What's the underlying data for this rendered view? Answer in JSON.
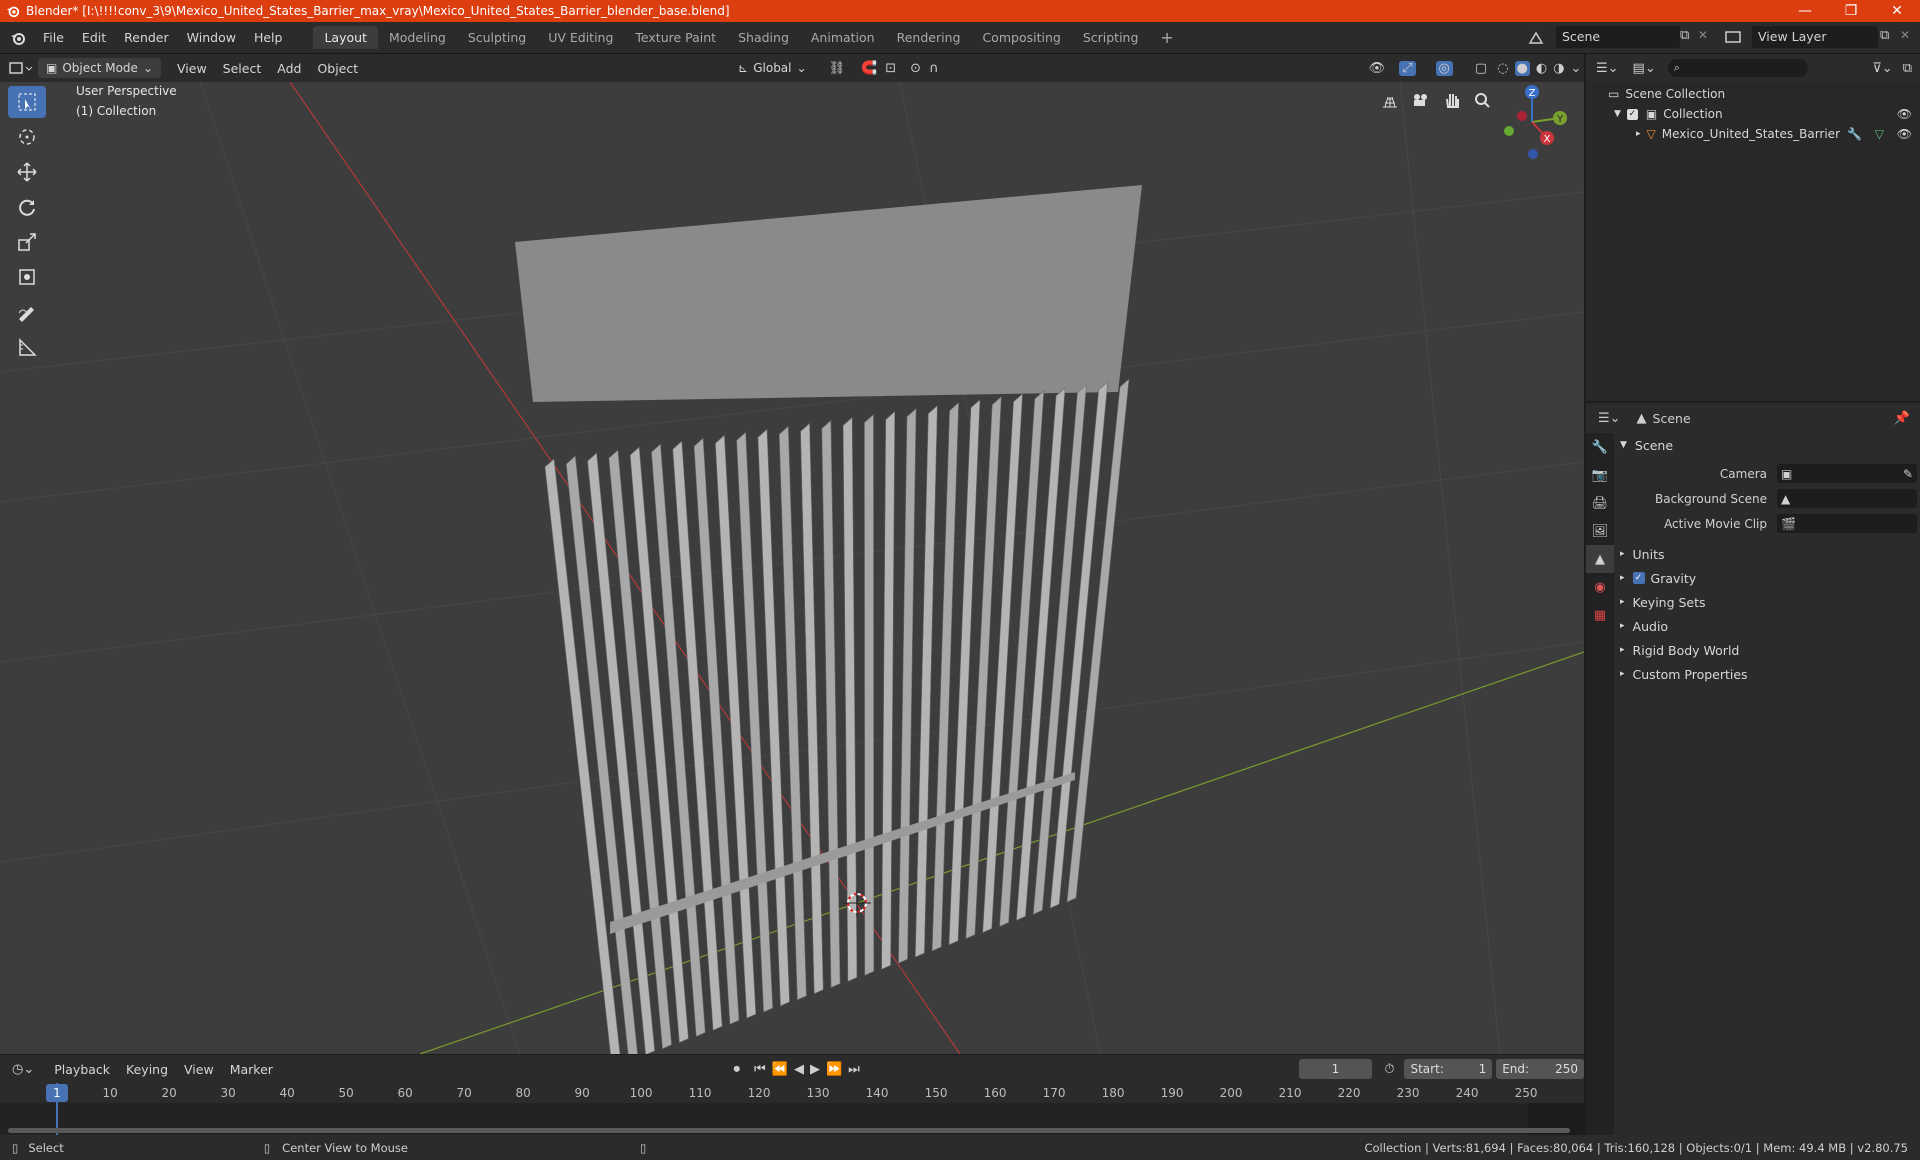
{
  "window": {
    "title": "Blender* [I:\\!!!!conv_3\\9\\Mexico_United_States_Barrier_max_vray\\Mexico_United_States_Barrier_blender_base.blend]",
    "minimize": "—",
    "maximize": "❐",
    "close": "✕"
  },
  "menus": [
    "File",
    "Edit",
    "Render",
    "Window",
    "Help"
  ],
  "workspaces": [
    "Layout",
    "Modeling",
    "Sculpting",
    "UV Editing",
    "Texture Paint",
    "Shading",
    "Animation",
    "Rendering",
    "Compositing",
    "Scripting"
  ],
  "active_workspace": "Layout",
  "scene_selector": {
    "value": "Scene"
  },
  "view_layer_selector": {
    "value": "View Layer"
  },
  "viewport_header": {
    "mode": "Object Mode",
    "menus": [
      "View",
      "Select",
      "Add",
      "Object"
    ],
    "orientation": "Global"
  },
  "viewport": {
    "perspective_label": "User Perspective",
    "collection_label": "(1) Collection",
    "gizmo": {
      "z": "Z",
      "y": "Y",
      "x": "X"
    }
  },
  "outliner": {
    "scene_collection": "Scene Collection",
    "collection": "Collection",
    "object": "Mexico_United_States_Barrier"
  },
  "properties": {
    "header_title": "Scene",
    "section_title": "Scene",
    "fields": [
      {
        "label": "Camera",
        "value": ""
      },
      {
        "label": "Background Scene",
        "value": ""
      },
      {
        "label": "Active Movie Clip",
        "value": ""
      }
    ],
    "subsections": [
      "Units",
      "Gravity",
      "Keying Sets",
      "Audio",
      "Rigid Body World",
      "Custom Properties"
    ]
  },
  "timeline": {
    "menus": [
      "Playback",
      "Keying",
      "View",
      "Marker"
    ],
    "current_frame": "1",
    "start_label": "Start:",
    "start": "1",
    "end_label": "End:",
    "end": "250",
    "ticks": [
      "1",
      "10",
      "20",
      "30",
      "40",
      "50",
      "60",
      "70",
      "80",
      "90",
      "100",
      "110",
      "120",
      "130",
      "140",
      "150",
      "160",
      "170",
      "180",
      "190",
      "200",
      "210",
      "220",
      "230",
      "240",
      "250"
    ]
  },
  "statusbar": {
    "left": "Select",
    "middle": "Center View to Mouse",
    "right": "Collection | Verts:81,694 | Faces:80,064 | Tris:160,128 | Objects:0/1 | Mem: 49.4 MB | v2.80.75"
  },
  "colors": {
    "title_bar": "#dc3e10",
    "accent": "#4772b3",
    "viewport_bg": "#3d3d3d",
    "axis_x": "#b03a3a",
    "axis_y": "#7a9a2e"
  }
}
